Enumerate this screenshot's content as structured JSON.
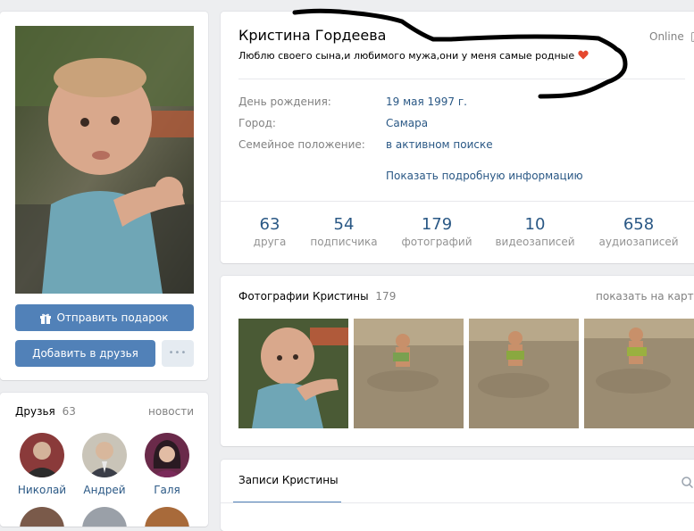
{
  "profile": {
    "name": "Кристина Гордеева",
    "status": "Люблю своего сына,и любимого мужа,они у меня самые родные",
    "online": "Online",
    "info": [
      {
        "label": "День рождения:",
        "value": "19 мая 1997 г."
      },
      {
        "label": "Город:",
        "value": "Самара"
      },
      {
        "label": "Семейное положение:",
        "value": "в активном поиске"
      }
    ],
    "more_info": "Показать подробную информацию"
  },
  "stats": [
    {
      "count": "63",
      "label": "друга"
    },
    {
      "count": "54",
      "label": "подписчика"
    },
    {
      "count": "179",
      "label": "фотографий"
    },
    {
      "count": "10",
      "label": "видеозаписей"
    },
    {
      "count": "658",
      "label": "аудиозаписей"
    }
  ],
  "actions": {
    "gift": "Отправить подарок",
    "add_friend": "Добавить в друзья",
    "more": "•••"
  },
  "friends": {
    "title": "Друзья",
    "count": "63",
    "news_link": "новости",
    "items": [
      {
        "name": "Николай"
      },
      {
        "name": "Андрей"
      },
      {
        "name": "Галя"
      }
    ]
  },
  "photos": {
    "title": "Фотографии Кристины",
    "count": "179",
    "map_link": "показать на карте"
  },
  "wall": {
    "title": "Записи Кристины"
  },
  "icons": {
    "gift": "gift-icon",
    "phone": "mobile-phone-icon",
    "heart": "heart-emoji-icon",
    "search": "search-icon"
  },
  "colors": {
    "accent": "#5181b8",
    "link": "#2a5885",
    "background": "#edeef0",
    "scribble": "#000000"
  }
}
